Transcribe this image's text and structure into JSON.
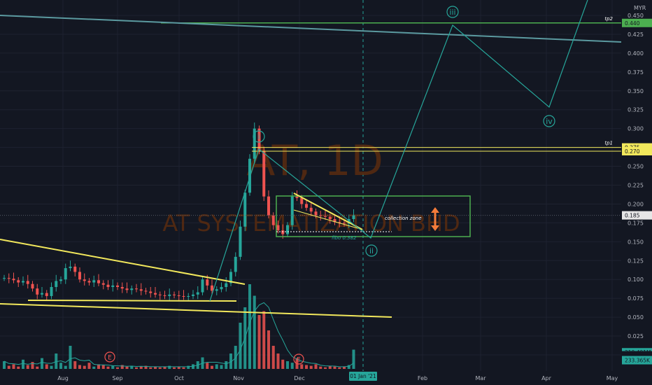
{
  "chart_data": {
    "type": "candlestick",
    "watermark": {
      "symbol": "AT, 1D",
      "name": "AT SYSTEMATIZATION BHD"
    },
    "currency": "MYR",
    "price_axis": {
      "ylim": [
        -0.01,
        0.46
      ],
      "ticks": [
        "0.450",
        "0.425",
        "0.400",
        "0.375",
        "0.350",
        "0.325",
        "0.300",
        "0.275",
        "0.250",
        "0.225",
        "0.200",
        "0.175",
        "0.150",
        "0.125",
        "0.100",
        "0.075",
        "0.050",
        "0.025",
        "0.000"
      ],
      "tick_values": [
        0.45,
        0.425,
        0.4,
        0.375,
        0.35,
        0.325,
        0.3,
        0.275,
        0.25,
        0.225,
        0.2,
        0.175,
        0.15,
        0.125,
        0.1,
        0.075,
        0.05,
        0.025,
        0.0
      ]
    },
    "time_axis": {
      "labels": [
        "Aug",
        "Sep",
        "Oct",
        "Nov",
        "Dec",
        "Feb",
        "Mar",
        "Apr",
        "May"
      ],
      "cursor_label": "01 Jan '21"
    },
    "price_tags": [
      {
        "label": "0.440",
        "value": 0.44,
        "color": "#4caf50",
        "note": "tp2"
      },
      {
        "label": "0.275",
        "value": 0.275,
        "color": "#f2e85c",
        "note": "tp1"
      },
      {
        "label": "0.270",
        "value": 0.27,
        "color": "#f2e85c",
        "note": ""
      },
      {
        "label": "0.185",
        "value": 0.185,
        "color": "#e6e6e6",
        "note": ""
      },
      {
        "label": "210.491M",
        "value": 0.0035,
        "color": "#26a69a",
        "note": ""
      },
      {
        "label": "-0.000",
        "value": -0.0005,
        "color": "#131722",
        "note": ""
      },
      {
        "label": "233.365K",
        "value": -0.007,
        "color": "#26a69a",
        "note": ""
      }
    ],
    "waves": [
      "iii",
      "i",
      "iv",
      "ii"
    ],
    "annotations": {
      "collection": "collection zone",
      "fibo": "fibo 0.382"
    },
    "earnings_marks": [
      "E",
      "E"
    ],
    "series": [
      {
        "name": "price_path",
        "values": [
          0.102,
          0.101,
          0.099,
          0.096,
          0.098,
          0.094,
          0.088,
          0.08,
          0.082,
          0.078,
          0.09,
          0.098,
          0.1,
          0.115,
          0.117,
          0.11,
          0.1,
          0.098,
          0.096,
          0.099,
          0.095,
          0.093,
          0.09,
          0.092,
          0.09,
          0.088,
          0.086,
          0.088,
          0.087,
          0.085,
          0.084,
          0.082,
          0.08,
          0.079,
          0.078,
          0.08,
          0.079,
          0.078,
          0.077,
          0.078,
          0.08,
          0.083,
          0.1,
          0.092,
          0.085,
          0.087,
          0.09,
          0.095,
          0.11,
          0.13,
          0.17,
          0.215,
          0.26,
          0.3,
          0.27,
          0.21,
          0.185,
          0.172,
          0.165,
          0.16,
          0.172,
          0.21,
          0.208,
          0.2,
          0.195,
          0.19,
          0.185,
          0.184,
          0.183,
          0.18,
          0.176,
          0.175,
          0.174,
          0.18,
          0.185
        ]
      },
      {
        "name": "volume",
        "values": [
          0.01,
          0.004,
          0.006,
          0.003,
          0.012,
          0.005,
          0.009,
          0.003,
          0.014,
          0.006,
          0.004,
          0.02,
          0.008,
          0.004,
          0.03,
          0.01,
          0.005,
          0.004,
          0.008,
          0.003,
          0.006,
          0.005,
          0.003,
          0.004,
          0.002,
          0.005,
          0.003,
          0.004,
          0.002,
          0.003,
          0.004,
          0.002,
          0.003,
          0.002,
          0.003,
          0.004,
          0.002,
          0.003,
          0.002,
          0.004,
          0.006,
          0.01,
          0.015,
          0.008,
          0.004,
          0.006,
          0.005,
          0.01,
          0.02,
          0.03,
          0.06,
          0.08,
          0.11,
          0.095,
          0.07,
          0.075,
          0.05,
          0.03,
          0.02,
          0.012,
          0.01,
          0.008,
          0.014,
          0.006,
          0.005,
          0.004,
          0.006,
          0.003,
          0.002,
          0.004,
          0.003,
          0.002,
          0.003,
          0.005,
          0.025
        ]
      }
    ]
  }
}
